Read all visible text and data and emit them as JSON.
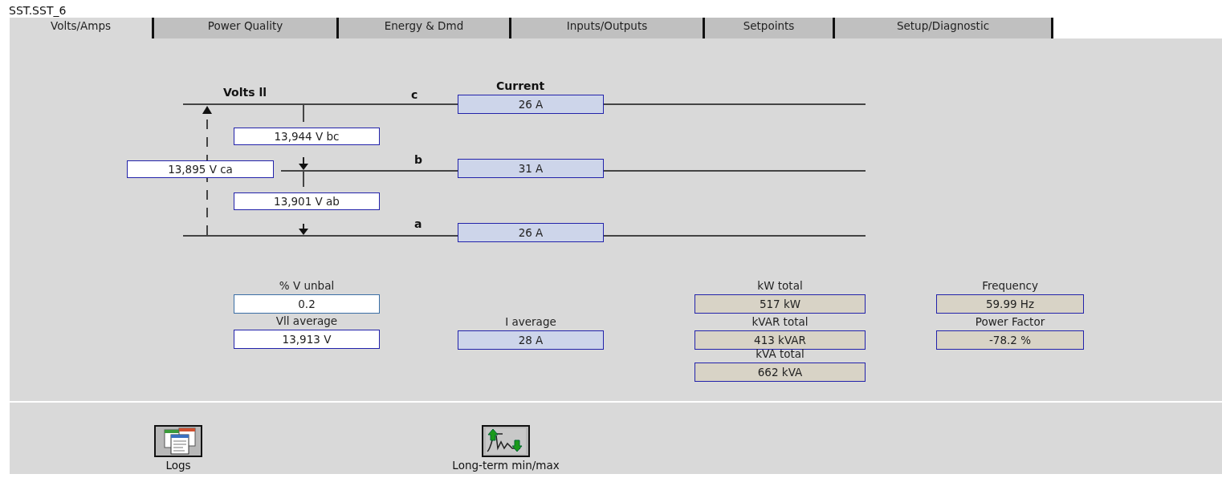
{
  "window": {
    "title": "SST.SST_6"
  },
  "tabs": [
    {
      "label": "Volts/Amps",
      "selected": true
    },
    {
      "label": "Power Quality",
      "selected": false
    },
    {
      "label": "Energy & Dmd",
      "selected": false
    },
    {
      "label": "Inputs/Outputs",
      "selected": false
    },
    {
      "label": "Setpoints",
      "selected": false
    },
    {
      "label": "Setup/Diagnostic",
      "selected": false
    }
  ],
  "diagram": {
    "voltage_heading": "Volts ll",
    "current_heading": "Current",
    "phases": [
      {
        "label": "c",
        "current": "26 A"
      },
      {
        "label": "b",
        "current": "31 A"
      },
      {
        "label": "a",
        "current": "26 A"
      }
    ],
    "line_voltages": [
      {
        "value": "13,944 V bc"
      },
      {
        "value": "13,895 V ca"
      },
      {
        "value": "13,901 V ab"
      }
    ]
  },
  "readouts": [
    {
      "label": "% V unbal",
      "value": "0.2",
      "kind": "plain"
    },
    {
      "label": "Vll average",
      "value": "13,913 V",
      "kind": "voltage"
    },
    {
      "label": "I average",
      "value": "28 A",
      "kind": "current"
    },
    {
      "label": "kW total",
      "value": "517 kW",
      "kind": "power"
    },
    {
      "label": "kVAR total",
      "value": "413 kVAR",
      "kind": "power"
    },
    {
      "label": "kVA total",
      "value": "662 kVA",
      "kind": "power"
    },
    {
      "label": "Frequency",
      "value": "59.99 Hz",
      "kind": "power"
    },
    {
      "label": "Power Factor",
      "value": "-78.2 %",
      "kind": "power"
    }
  ],
  "shortcuts": [
    {
      "label": "Logs",
      "kind": "logs"
    },
    {
      "label": "Long-term min/max",
      "kind": "minmax"
    }
  ]
}
